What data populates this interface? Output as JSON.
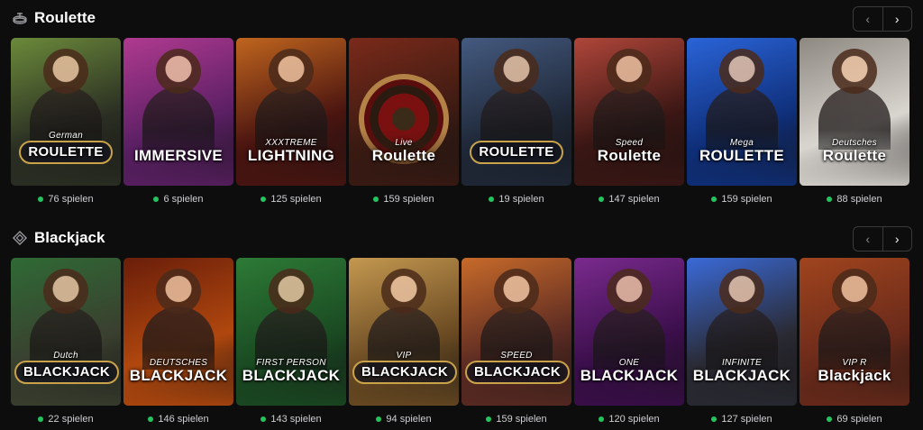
{
  "accent": "#22c55e",
  "sections": [
    {
      "title": "Roulette",
      "icon": "roulette-icon",
      "prev_label": "‹",
      "next_label": "›",
      "games": [
        {
          "logo_sub": "German",
          "logo_main": "ROULETTE",
          "players": "76 spielen",
          "bg": "#2b2f23",
          "accent": "#6b8a3a",
          "style": "plate"
        },
        {
          "logo_sub": "",
          "logo_main": "IMMERSIVE",
          "players": "6 spielen",
          "bg": "#5a1f63",
          "accent": "#b03a90",
          "style": "plain"
        },
        {
          "logo_sub": "XXXTREME",
          "logo_main": "LIGHTNING",
          "players": "125 spielen",
          "bg": "#4a1410",
          "accent": "#c0651e",
          "style": "plain"
        },
        {
          "logo_sub": "Live",
          "logo_main": "Roulette",
          "players": "159 spielen",
          "bg": "#3a1a12",
          "accent": "#7a2a1a",
          "style": "wheel"
        },
        {
          "logo_sub": "",
          "logo_main": "ROULETTE",
          "players": "19 spielen",
          "bg": "#1f2838",
          "accent": "#445a80",
          "style": "plate"
        },
        {
          "logo_sub": "Speed",
          "logo_main": "Roulette",
          "players": "147 spielen",
          "bg": "#3a1613",
          "accent": "#b0463a",
          "style": "plain"
        },
        {
          "logo_sub": "Mega",
          "logo_main": "ROULETTE",
          "players": "159 spielen",
          "bg": "#0f2f7a",
          "accent": "#2a64d8",
          "style": "plain"
        },
        {
          "logo_sub": "Deutsches",
          "logo_main": "Roulette",
          "players": "88 spielen",
          "bg": "#d9d5cf",
          "accent": "#8d8880",
          "style": "plain"
        }
      ]
    },
    {
      "title": "Blackjack",
      "icon": "diamond-cards-icon",
      "prev_label": "‹",
      "next_label": "›",
      "games": [
        {
          "logo_sub": "Dutch",
          "logo_main": "BLACKJACK",
          "players": "22 spielen",
          "bg": "#3a3f2f",
          "accent": "#2f6a35",
          "style": "plate"
        },
        {
          "logo_sub": "DEUTSCHES",
          "logo_main": "BLACKJACK",
          "players": "146 spielen",
          "bg": "#b0470e",
          "accent": "#6a1e0a",
          "style": "plain"
        },
        {
          "logo_sub": "FIRST PERSON",
          "logo_main": "BLACKJACK",
          "players": "143 spielen",
          "bg": "#1a4a22",
          "accent": "#2d7a36",
          "style": "plain"
        },
        {
          "logo_sub": "VIP",
          "logo_main": "BLACKJACK",
          "players": "94 spielen",
          "bg": "#6a4a22",
          "accent": "#c49850",
          "style": "plate"
        },
        {
          "logo_sub": "SPEED",
          "logo_main": "BLACKJACK",
          "players": "159 spielen",
          "bg": "#5a2a22",
          "accent": "#c86a2a",
          "style": "plate"
        },
        {
          "logo_sub": "ONE",
          "logo_main": "BLACKJACK",
          "players": "120 spielen",
          "bg": "#3a0e4a",
          "accent": "#7a2a8e",
          "style": "plain"
        },
        {
          "logo_sub": "INFINITE",
          "logo_main": "BLACKJACK",
          "players": "127 spielen",
          "bg": "#2a2a33",
          "accent": "#3a6ad8",
          "style": "plain"
        },
        {
          "logo_sub": "VIP R",
          "logo_main": "Blackjack",
          "players": "69 spielen",
          "bg": "#6a2a1a",
          "accent": "#a0441e",
          "style": "plain"
        }
      ]
    }
  ]
}
